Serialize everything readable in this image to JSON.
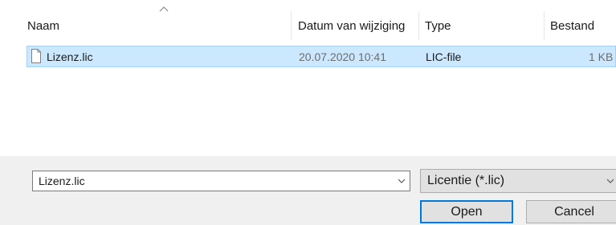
{
  "columns": {
    "name": "Naam",
    "date": "Datum van wijziging",
    "type": "Type",
    "size": "Bestand"
  },
  "files": [
    {
      "name": "Lizenz.lic",
      "date": "20.07.2020 10:41",
      "type": "LIC-file",
      "size": "1 KB",
      "selected": true
    }
  ],
  "filename_input": {
    "value": "Lizenz.lic"
  },
  "file_type_filter": {
    "value": "Licentie (*.lic)"
  },
  "buttons": {
    "open": "Open",
    "cancel": "Cancel"
  },
  "colors": {
    "selection_fill": "#cce8ff",
    "selection_border": "#99d1ff",
    "default_button_border": "#0078d7",
    "panel_background": "#f0f0f0"
  },
  "icons": {
    "sort": "sort-ascending-icon",
    "file": "file-icon",
    "dropdown": "chevron-down-icon"
  }
}
